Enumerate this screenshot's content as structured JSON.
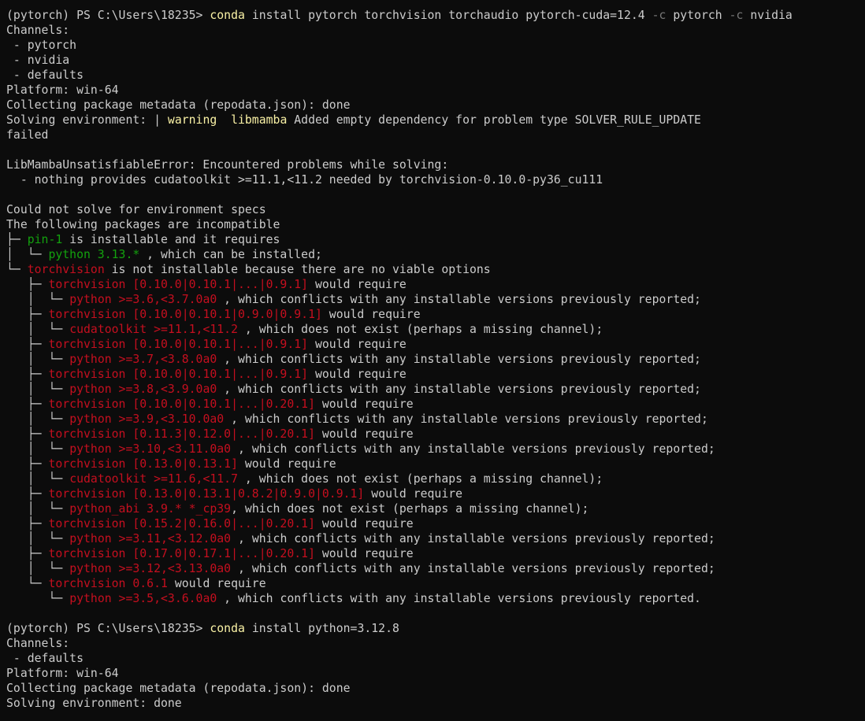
{
  "colors": {
    "background": "#0c0c0c",
    "foreground": "#cccccc",
    "yellow": "#f9f1a5",
    "green": "#13a10e",
    "red": "#c50f1f",
    "gray": "#767676"
  },
  "lines": [
    [
      {
        "t": "(pytorch) PS C:\\Users\\18235> "
      },
      {
        "t": "conda",
        "c": "yellow"
      },
      {
        "t": " install pytorch torchvision torchaudio pytorch-cuda=12.4 "
      },
      {
        "t": "-c",
        "c": "gray"
      },
      {
        "t": " pytorch "
      },
      {
        "t": "-c",
        "c": "gray"
      },
      {
        "t": " nvidia"
      }
    ],
    [
      {
        "t": "Channels:"
      }
    ],
    [
      {
        "t": " - pytorch"
      }
    ],
    [
      {
        "t": " - nvidia"
      }
    ],
    [
      {
        "t": " - defaults"
      }
    ],
    [
      {
        "t": "Platform: win-64"
      }
    ],
    [
      {
        "t": "Collecting package metadata (repodata.json): done"
      }
    ],
    [
      {
        "t": "Solving environment: | "
      },
      {
        "t": "warning  libmamba",
        "c": "yellow"
      },
      {
        "t": " Added empty dependency for problem type SOLVER_RULE_UPDATE"
      }
    ],
    [
      {
        "t": "failed"
      }
    ],
    [
      {
        "t": ""
      }
    ],
    [
      {
        "t": "LibMambaUnsatisfiableError: Encountered problems while solving:"
      }
    ],
    [
      {
        "t": "  - nothing provides cudatoolkit >=11.1,<11.2 needed by torchvision-0.10.0-py36_cu111"
      }
    ],
    [
      {
        "t": ""
      }
    ],
    [
      {
        "t": "Could not solve for environment specs"
      }
    ],
    [
      {
        "t": "The following packages are incompatible"
      }
    ],
    [
      {
        "t": "├─ "
      },
      {
        "t": "pin-1",
        "c": "green"
      },
      {
        "t": " is installable and it requires"
      }
    ],
    [
      {
        "t": "│  └─ "
      },
      {
        "t": "python 3.13.*",
        "c": "green"
      },
      {
        "t": " , which can be installed;"
      }
    ],
    [
      {
        "t": "└─ "
      },
      {
        "t": "torchvision",
        "c": "red"
      },
      {
        "t": " is not installable because there are no viable options"
      }
    ],
    [
      {
        "t": "   ├─ "
      },
      {
        "t": "torchvision [0.10.0|0.10.1|...|0.9.1]",
        "c": "red"
      },
      {
        "t": " would require"
      }
    ],
    [
      {
        "t": "   │  └─ "
      },
      {
        "t": "python >=3.6,<3.7.0a0",
        "c": "red"
      },
      {
        "t": " , which conflicts with any installable versions previously reported;"
      }
    ],
    [
      {
        "t": "   ├─ "
      },
      {
        "t": "torchvision [0.10.0|0.10.1|0.9.0|0.9.1]",
        "c": "red"
      },
      {
        "t": " would require"
      }
    ],
    [
      {
        "t": "   │  └─ "
      },
      {
        "t": "cudatoolkit >=11.1,<11.2",
        "c": "red"
      },
      {
        "t": " , which does not exist (perhaps a missing channel);"
      }
    ],
    [
      {
        "t": "   ├─ "
      },
      {
        "t": "torchvision [0.10.0|0.10.1|...|0.9.1]",
        "c": "red"
      },
      {
        "t": " would require"
      }
    ],
    [
      {
        "t": "   │  └─ "
      },
      {
        "t": "python >=3.7,<3.8.0a0",
        "c": "red"
      },
      {
        "t": " , which conflicts with any installable versions previously reported;"
      }
    ],
    [
      {
        "t": "   ├─ "
      },
      {
        "t": "torchvision [0.10.0|0.10.1|...|0.9.1]",
        "c": "red"
      },
      {
        "t": " would require"
      }
    ],
    [
      {
        "t": "   │  └─ "
      },
      {
        "t": "python >=3.8,<3.9.0a0",
        "c": "red"
      },
      {
        "t": " , which conflicts with any installable versions previously reported;"
      }
    ],
    [
      {
        "t": "   ├─ "
      },
      {
        "t": "torchvision [0.10.0|0.10.1|...|0.20.1]",
        "c": "red"
      },
      {
        "t": " would require"
      }
    ],
    [
      {
        "t": "   │  └─ "
      },
      {
        "t": "python >=3.9,<3.10.0a0",
        "c": "red"
      },
      {
        "t": " , which conflicts with any installable versions previously reported;"
      }
    ],
    [
      {
        "t": "   ├─ "
      },
      {
        "t": "torchvision [0.11.3|0.12.0|...|0.20.1]",
        "c": "red"
      },
      {
        "t": " would require"
      }
    ],
    [
      {
        "t": "   │  └─ "
      },
      {
        "t": "python >=3.10,<3.11.0a0",
        "c": "red"
      },
      {
        "t": " , which conflicts with any installable versions previously reported;"
      }
    ],
    [
      {
        "t": "   ├─ "
      },
      {
        "t": "torchvision [0.13.0|0.13.1]",
        "c": "red"
      },
      {
        "t": " would require"
      }
    ],
    [
      {
        "t": "   │  └─ "
      },
      {
        "t": "cudatoolkit >=11.6,<11.7",
        "c": "red"
      },
      {
        "t": " , which does not exist (perhaps a missing channel);"
      }
    ],
    [
      {
        "t": "   ├─ "
      },
      {
        "t": "torchvision [0.13.0|0.13.1|0.8.2|0.9.0|0.9.1]",
        "c": "red"
      },
      {
        "t": " would require"
      }
    ],
    [
      {
        "t": "   │  └─ "
      },
      {
        "t": "python_abi 3.9.* *_cp39",
        "c": "red"
      },
      {
        "t": ", which does not exist (perhaps a missing channel);"
      }
    ],
    [
      {
        "t": "   ├─ "
      },
      {
        "t": "torchvision [0.15.2|0.16.0|...|0.20.1]",
        "c": "red"
      },
      {
        "t": " would require"
      }
    ],
    [
      {
        "t": "   │  └─ "
      },
      {
        "t": "python >=3.11,<3.12.0a0",
        "c": "red"
      },
      {
        "t": " , which conflicts with any installable versions previously reported;"
      }
    ],
    [
      {
        "t": "   ├─ "
      },
      {
        "t": "torchvision [0.17.0|0.17.1|...|0.20.1]",
        "c": "red"
      },
      {
        "t": " would require"
      }
    ],
    [
      {
        "t": "   │  └─ "
      },
      {
        "t": "python >=3.12,<3.13.0a0",
        "c": "red"
      },
      {
        "t": " , which conflicts with any installable versions previously reported;"
      }
    ],
    [
      {
        "t": "   └─ "
      },
      {
        "t": "torchvision 0.6.1",
        "c": "red"
      },
      {
        "t": " would require"
      }
    ],
    [
      {
        "t": "      └─ "
      },
      {
        "t": "python >=3.5,<3.6.0a0",
        "c": "red"
      },
      {
        "t": " , which conflicts with any installable versions previously reported."
      }
    ],
    [
      {
        "t": ""
      }
    ],
    [
      {
        "t": "(pytorch) PS C:\\Users\\18235> "
      },
      {
        "t": "conda",
        "c": "yellow"
      },
      {
        "t": " install python=3.12.8"
      }
    ],
    [
      {
        "t": "Channels:"
      }
    ],
    [
      {
        "t": " - defaults"
      }
    ],
    [
      {
        "t": "Platform: win-64"
      }
    ],
    [
      {
        "t": "Collecting package metadata (repodata.json): done"
      }
    ],
    [
      {
        "t": "Solving environment: done"
      }
    ]
  ]
}
